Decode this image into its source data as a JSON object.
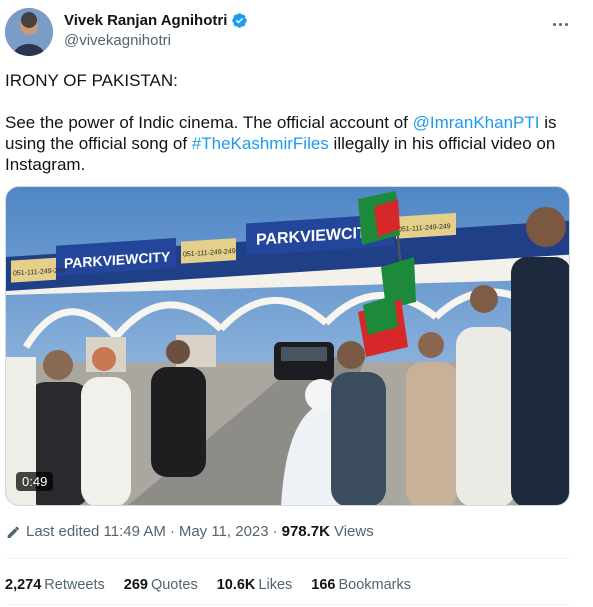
{
  "author": {
    "display_name": "Vivek Ranjan Agnihotri",
    "handle": "@vivekagnihotri",
    "verified": true,
    "verified_color": "#1d9bf0"
  },
  "tweet": {
    "headline": "IRONY OF PAKISTAN:",
    "body_part1": "See the power of Indic cinema. The official account of ",
    "mention": "@ImranKhanPTI",
    "body_part2": " is using the official song of ",
    "hashtag": "#TheKashmirFiles",
    "body_part3": " illegally in his official video on Instagram.",
    "link_color": "#1d9bf0"
  },
  "media": {
    "type": "video",
    "duration": "0:49",
    "sign_text_1": "PARKVIEWCITY",
    "sign_text_2": "PARKVIEWCITY",
    "phone_text_1": "051-111-249-249",
    "phone_text_2": "051-111-249-249",
    "phone_text_3": "051-111-249-249"
  },
  "meta": {
    "edited_label": "Last edited 11:49 AM",
    "separator": "·",
    "date": "May 11, 2023",
    "views_count": "978.7K",
    "views_label": "Views"
  },
  "stats": {
    "retweets_count": "2,274",
    "retweets_label": "Retweets",
    "quotes_count": "269",
    "quotes_label": "Quotes",
    "likes_count": "10.6K",
    "likes_label": "Likes",
    "bookmarks_count": "166",
    "bookmarks_label": "Bookmarks"
  }
}
